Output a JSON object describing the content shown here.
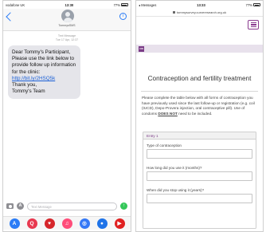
{
  "left_phone": {
    "status": {
      "carrier": "vodafone UK",
      "time": "13:30",
      "battery": "77%"
    },
    "contact": {
      "name": "TommysSMS",
      "info_glyph": "i"
    },
    "meta": {
      "type": "Text Message",
      "timestamp": "Tue 17 Apr, 12:37"
    },
    "message": {
      "lines": [
        "Dear Tommy's Participant,",
        "Please use the link below to",
        "provide follow up information",
        "for the clinic:"
      ],
      "link": "http://bit.ly/2HSQ5k",
      "closing": [
        "Thank you,",
        "Tommy's Team"
      ]
    },
    "composer": {
      "placeholder": "Text Message",
      "appstore_glyph": "A",
      "send_glyph": "↑"
    },
    "app_tray": [
      {
        "icon": "app-store-icon",
        "glyph": "A",
        "color": "#2a7cf6"
      },
      {
        "icon": "search-images-icon",
        "glyph": "Q",
        "color": "#e8384f"
      },
      {
        "icon": "heart-sticker-icon",
        "glyph": "♥",
        "color": "#d6262b"
      },
      {
        "icon": "music-icon",
        "glyph": "♫",
        "color": "#ff4d7a"
      },
      {
        "icon": "apps-icon",
        "glyph": "◎",
        "color": "#3478f6"
      },
      {
        "icon": "photo-icon",
        "glyph": "●",
        "color": "#1e73e8"
      },
      {
        "icon": "video-icon",
        "glyph": "▶",
        "color": "#e02020"
      }
    ]
  },
  "right_phone": {
    "status": {
      "back_app": "◂ Messages",
      "time": "13:33",
      "battery": "77%"
    },
    "url": "tommysurvey.curveresearch.org.uk",
    "site_badge": "ON",
    "form": {
      "title": "Contraception and fertility treatment",
      "instructions": "Please complete the table below with all forms of contraception you have previously used since the last follow-up or registration (e.g. coil (IUCD), Depo-Provera injection, oral contraceptive pill). Use of condoms",
      "instructions_strong": "DOES NOT",
      "instructions_end": "need to be included.",
      "entry_label": "Entry 1",
      "fields": [
        "Type of contraception",
        "How long did you use it (months)?",
        "When did you stop using it (years)?"
      ]
    }
  },
  "colors": {
    "ios_blue": "#2a7cf6",
    "bubble_grey": "#e5e5ea",
    "brand_purple": "#7a3b86"
  }
}
